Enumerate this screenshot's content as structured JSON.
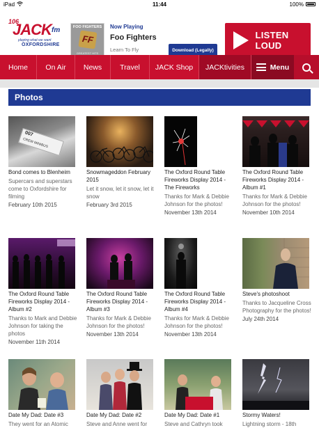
{
  "status": {
    "time": "11:44",
    "device": "iPad",
    "battery": "100%"
  },
  "header": {
    "logo_number": "106",
    "logo_name": "JACK",
    "logo_fm": "fm",
    "logo_tagline": "playing what we want",
    "logo_region": "OXFORDSHIRE",
    "now_playing_label": "Now Playing",
    "artist": "Foo Fighters",
    "track": "Learn To Fly",
    "album_band": "FOO FIGHTERS",
    "album_logo": "FF",
    "album_caption": "GREATEST HITS",
    "download_label": "Download (Legally)",
    "listen_label": "LISTEN LOUD"
  },
  "nav": {
    "items": [
      "Home",
      "On Air",
      "News",
      "Travel",
      "JACK Shop",
      "JACKtivities"
    ],
    "menu_label": "Menu"
  },
  "section_title": "Photos",
  "colors": {
    "brand_red": "#c8102e",
    "brand_blue": "#1f3a93"
  },
  "photos": [
    {
      "title": "Bond comes to Blenheim",
      "desc": "Supercars and superstars come to Oxfordshire for filming",
      "date": "February 10th 2015"
    },
    {
      "title": "Snowmageddon February 2015",
      "desc": "Let it snow, let it snow, let it snow",
      "date": "February 3rd 2015"
    },
    {
      "title": "The Oxford Round Table Fireworks Display 2014 - The Fireworks",
      "desc": "Thanks for Mark & Debbie Johnson for the photos!",
      "date": "November 13th 2014"
    },
    {
      "title": "The Oxford Round Table Fireworks Display 2014 - Album #1",
      "desc": "Thanks for Mark & Debbie Johnson for the photos!",
      "date": "November 10th 2014"
    },
    {
      "title": "The Oxford Round Table Fireworks Display 2014 - Album #2",
      "desc": "Thanks to Mark and Debbie Johnson for taking the photos",
      "date": "November 11th 2014"
    },
    {
      "title": "The Oxford Round Table Fireworks Display 2014 - Album #3",
      "desc": "Thanks for Mark & Debbie Johnson for the photos!",
      "date": "November 13th 2014"
    },
    {
      "title": "The Oxford Round Table Fireworks Display 2014 - Album #4",
      "desc": "Thanks for Mark & Debbie Johnson for the photos!",
      "date": "November 13th 2014"
    },
    {
      "title": "Steve's photoshoot",
      "desc": "Thanks to Jacqueline Cross Photography for the photos!",
      "date": "July 24th 2014"
    },
    {
      "title": "Date My Dad: Date #3",
      "desc": "They went for an Atomic",
      "date": ""
    },
    {
      "title": "Date My Dad: Date #2",
      "desc": "Steve and Anne went for",
      "date": ""
    },
    {
      "title": "Date My Dad: Date #1",
      "desc": "Steve and Cathryn took",
      "date": ""
    },
    {
      "title": "Stormy Waters!",
      "desc": "Lightning storm - 18th",
      "date": ""
    }
  ],
  "bond_sign": "CREW MINIBUS",
  "bond_logo": "007"
}
